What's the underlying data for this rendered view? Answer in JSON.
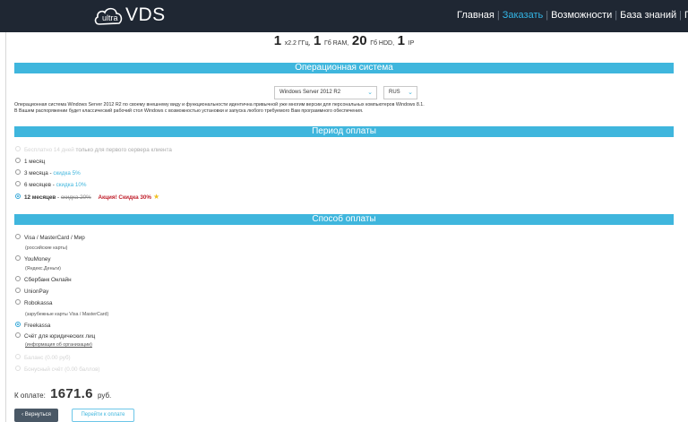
{
  "header": {
    "logo_small": "ultra",
    "logo_text": "VDS",
    "nav": [
      {
        "label": "Главная",
        "active": false
      },
      {
        "label": "Заказать",
        "active": true
      },
      {
        "label": "Возможности",
        "active": false
      },
      {
        "label": "База знаний",
        "active": false
      },
      {
        "label": "П",
        "active": false
      }
    ]
  },
  "specs": {
    "cpu_count": "1",
    "cpu_unit": "x2.2 ГГц,",
    "ram": "1",
    "ram_unit": "Гб RAM,",
    "hdd": "20",
    "hdd_unit": "Гб HDD,",
    "ip": "1",
    "ip_unit": "IP"
  },
  "os_section": {
    "title": "Операционная система",
    "os_select_value": "Windows Server 2012 R2",
    "lang_select_value": "RUS",
    "description_line1": "Операционная система Windows Server 2012 R2 по своему внешнему виду и функциональности идентична привычной уже многим версии для персональных компьютеров Windows 8.1.",
    "description_line2": "В Вашем распоряжении будет классический рабочий стол Windows с возможностью установки и запуска любого требуемого Вам программного обеспечения."
  },
  "period_section": {
    "title": "Период оплаты",
    "options": {
      "trial_label": "Бесплатно 14 дней",
      "trial_note": "только для первого сервера клиента",
      "m1_label": "1 месяц",
      "m3_label": "3 месяца",
      "m3_discount": "скидка 5%",
      "m6_label": "6 месяцев",
      "m6_discount": "скидка 10%",
      "m12_label": "12 месяцев",
      "m12_old_discount": "скидка 20%",
      "m12_promo": "Акция! Скидка 30%"
    }
  },
  "payment_section": {
    "title": "Способ оплаты",
    "visa_label": "Visa / MasterCard / Мир",
    "visa_note": "(российские карты)",
    "yoomoney_label": "YouMoney",
    "yoomoney_note": "(Яндекс.Деньги)",
    "sber_label": "Сбербанк Онлайн",
    "unionpay_label": "UnionPay",
    "robokassa_label": "Robokassa",
    "robokassa_note": "(зарубежные карты Visa / MasterCard)",
    "freekassa_label": "Freekassa",
    "legal_label": "Счёт для юридических лиц",
    "legal_note": "(информация об организации)",
    "balance_label": "Баланс (0.00 руб)",
    "bonus_label": "Бонусный счёт (0.00 баллов)"
  },
  "total": {
    "label": "К оплате:",
    "amount": "1671.6",
    "currency": "руб."
  },
  "buttons": {
    "back": "‹ Вернуться",
    "pay": "Перейти к оплате"
  },
  "colors": {
    "header_bg": "#1f2733",
    "accent": "#3fb6dd",
    "promo": "#c0202c"
  }
}
